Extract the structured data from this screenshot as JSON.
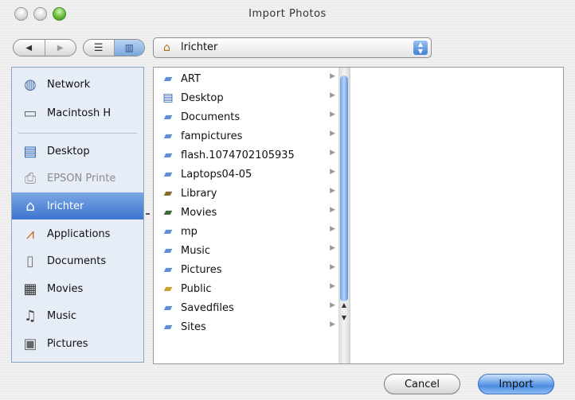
{
  "window": {
    "title": "Import Photos"
  },
  "toolbar": {
    "back_icon": "back-arrow-icon",
    "forward_icon": "forward-arrow-icon",
    "view_list_icon": "list-view-icon",
    "view_column_icon": "column-view-icon",
    "path": {
      "icon": "home-icon",
      "label": "lrichter"
    }
  },
  "sidebar": {
    "items": [
      {
        "label": "Network",
        "icon": "globe-icon"
      },
      {
        "label": "Macintosh H",
        "icon": "hard-drive-icon"
      },
      {
        "label": "Desktop",
        "icon": "desktop-icon"
      },
      {
        "label": "EPSON Printe",
        "icon": "printer-icon"
      },
      {
        "label": "lrichter",
        "icon": "home-icon"
      },
      {
        "label": "Applications",
        "icon": "applications-icon"
      },
      {
        "label": "Documents",
        "icon": "document-icon"
      },
      {
        "label": "Movies",
        "icon": "movies-icon"
      },
      {
        "label": "Music",
        "icon": "music-icon"
      },
      {
        "label": "Pictures",
        "icon": "pictures-icon"
      }
    ]
  },
  "browser": {
    "items": [
      {
        "name": "ART",
        "icon": "folder-icon"
      },
      {
        "name": "Desktop",
        "icon": "desktop-folder-icon"
      },
      {
        "name": "Documents",
        "icon": "documents-folder-icon"
      },
      {
        "name": "fampictures",
        "icon": "folder-icon"
      },
      {
        "name": "flash.1074702105935",
        "icon": "folder-icon"
      },
      {
        "name": "Laptops04-05",
        "icon": "folder-icon"
      },
      {
        "name": "Library",
        "icon": "library-folder-icon"
      },
      {
        "name": "Movies",
        "icon": "movies-folder-icon"
      },
      {
        "name": "mp",
        "icon": "folder-icon"
      },
      {
        "name": "Music",
        "icon": "music-folder-icon"
      },
      {
        "name": "Pictures",
        "icon": "pictures-folder-icon"
      },
      {
        "name": "Public",
        "icon": "public-folder-icon"
      },
      {
        "name": "Savedfiles",
        "icon": "folder-icon"
      },
      {
        "name": "Sites",
        "icon": "sites-folder-icon"
      }
    ]
  },
  "buttons": {
    "cancel": "Cancel",
    "import": "Import"
  }
}
